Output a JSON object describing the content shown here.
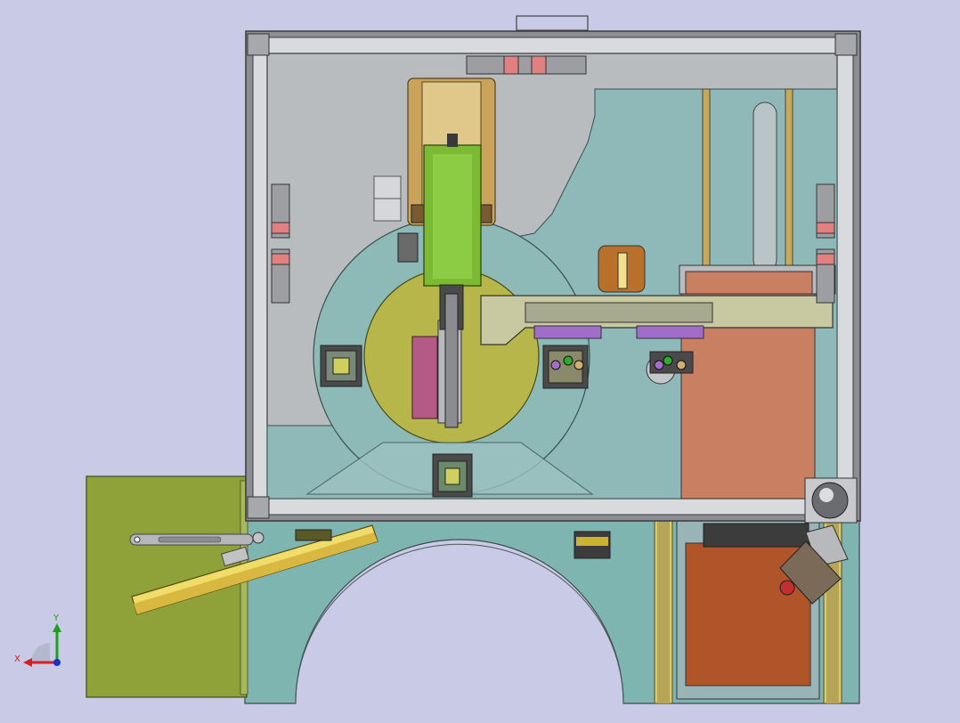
{
  "viewport": {
    "background": "#c9cae6"
  },
  "triad": {
    "x_label": "X",
    "y_label": "Y",
    "x_color": "#d42020",
    "y_color": "#1aa01a",
    "z_color": "#2030c0"
  },
  "colors": {
    "frame": "#8c8e93",
    "frame_light": "#d9dadd",
    "enclosure_fill": "#b9bcbf",
    "teal_region": "#8fb8b8",
    "base_plate": "#7fb5b0",
    "olive_panel": "#8fa23a",
    "green_carriage": "#7cba34",
    "tan_block": "#c9a35a",
    "orange_plate": "#b8643a",
    "rotary_disc": "#b7b64a",
    "magenta_block": "#b45a86",
    "yellow_bar": "#f0dc68",
    "gripper_purple": "#a06ec8"
  }
}
